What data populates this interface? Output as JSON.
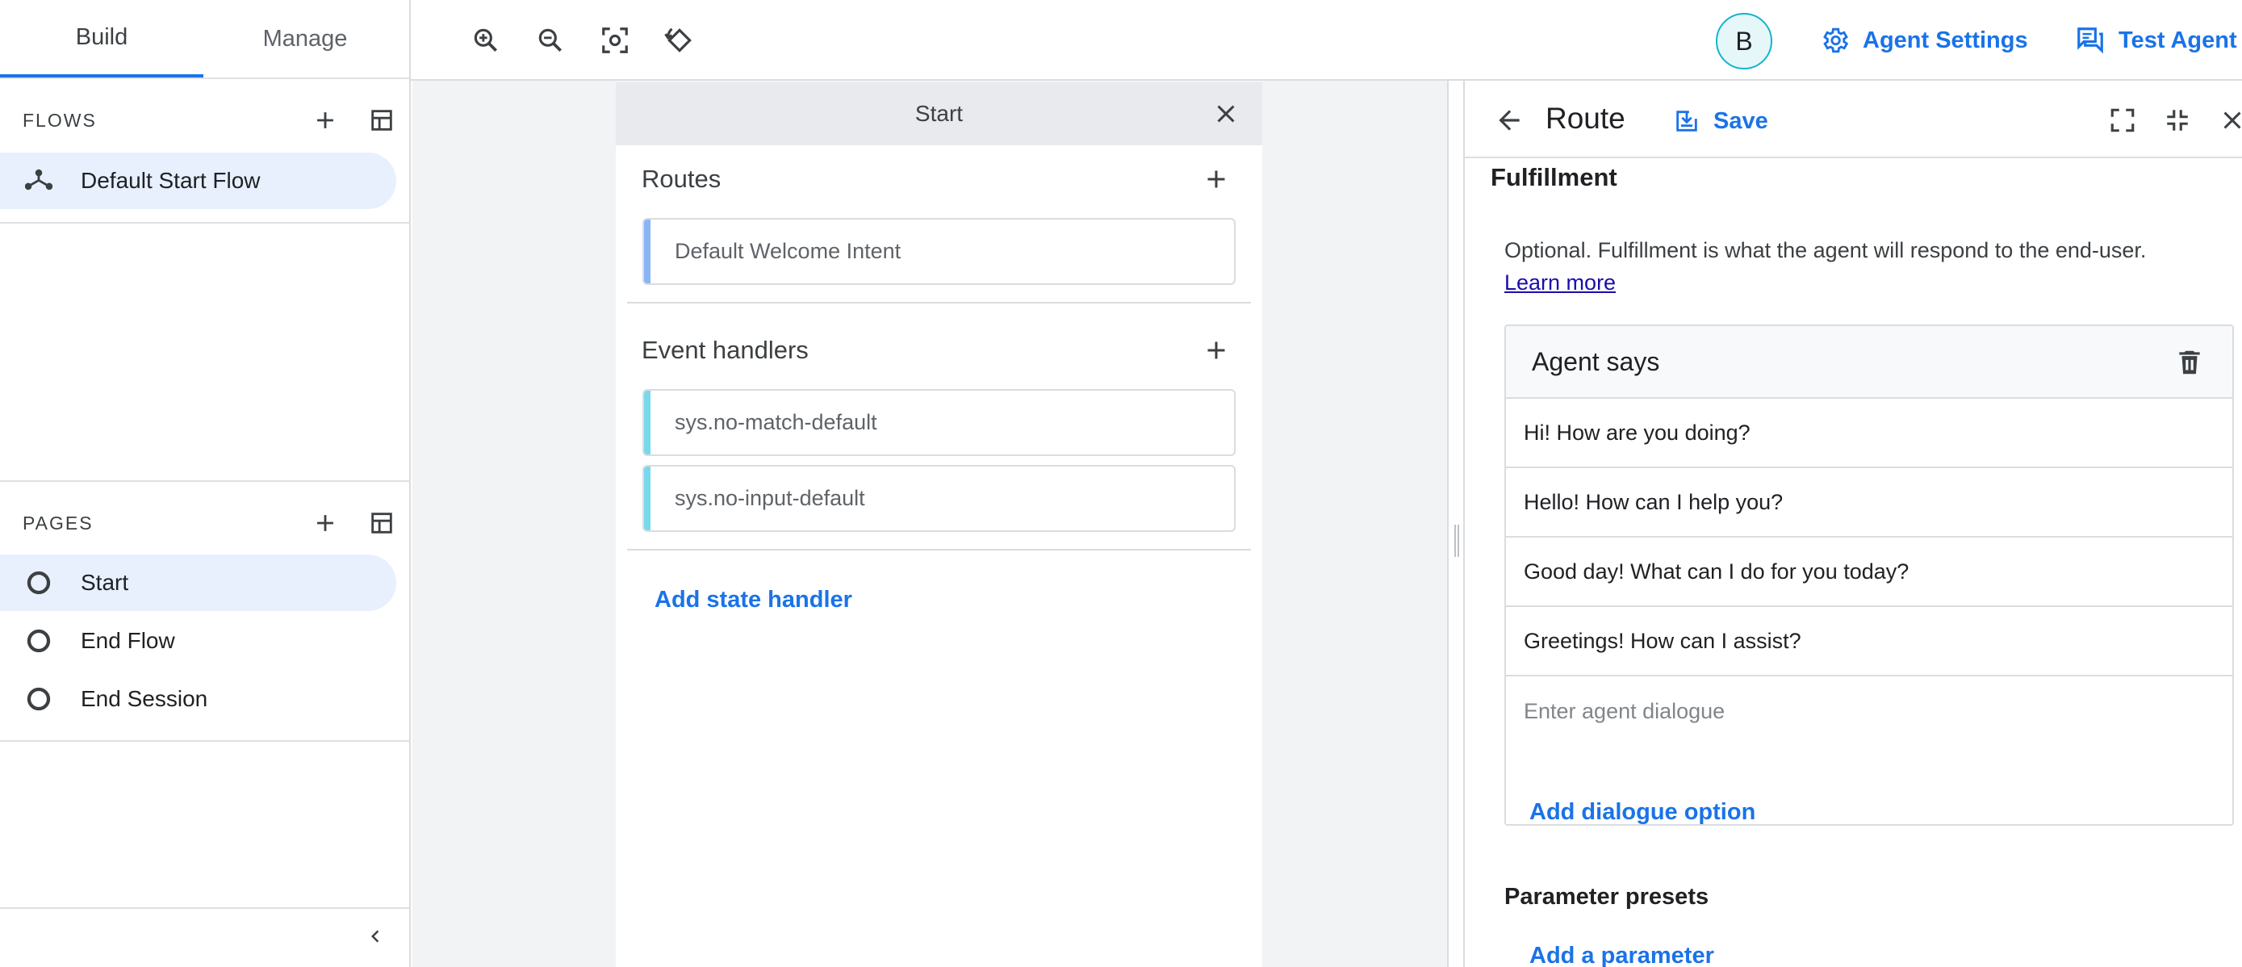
{
  "sidebar": {
    "tabs": [
      {
        "label": "Build",
        "active": true
      },
      {
        "label": "Manage",
        "active": false
      }
    ],
    "flows": {
      "title": "FLOWS",
      "items": [
        {
          "label": "Default Start Flow",
          "icon": "flow-icon",
          "selected": true
        }
      ]
    },
    "pages": {
      "title": "PAGES",
      "items": [
        {
          "label": "Start",
          "icon": "page-circle-icon",
          "selected": true
        },
        {
          "label": "End Flow",
          "icon": "page-circle-icon",
          "selected": false
        },
        {
          "label": "End Session",
          "icon": "page-circle-icon",
          "selected": false
        }
      ]
    }
  },
  "toolbar": {
    "tools": [
      "zoom-in-icon",
      "zoom-out-icon",
      "fit-screen-icon",
      "reset-rotate-icon"
    ],
    "avatar_letter": "B",
    "agent_settings": "Agent Settings",
    "test_agent": "Test Agent"
  },
  "start_card": {
    "title": "Start",
    "routes": {
      "title": "Routes",
      "items": [
        "Default Welcome Intent"
      ]
    },
    "event_handlers": {
      "title": "Event handlers",
      "items": [
        "sys.no-match-default",
        "sys.no-input-default"
      ]
    },
    "add_state_handler": "Add state handler"
  },
  "route_panel": {
    "title": "Route",
    "save_label": "Save",
    "fulfillment_title": "Fulfillment",
    "fulfillment_description": "Optional. Fulfillment is what the agent will respond to the end-user.",
    "learn_more": "Learn more",
    "agent_says": {
      "title": "Agent says",
      "dialogues": [
        "Hi! How are you doing?",
        "Hello! How can I help you?",
        "Good day! What can I do for you today?",
        "Greetings! How can I assist?"
      ],
      "input_placeholder": "Enter agent dialogue"
    },
    "add_dialogue_option": "Add dialogue option",
    "parameter_presets_title": "Parameter presets",
    "add_parameter": "Add a parameter"
  },
  "colors": {
    "accent": "#1a73e8",
    "selected_bg": "#e8f0fe",
    "canvas_bg": "#f1f3f4",
    "intent_bar": "#8ab4f8",
    "event_bar": "#78d9ec",
    "avatar_border": "#12b5cb"
  }
}
